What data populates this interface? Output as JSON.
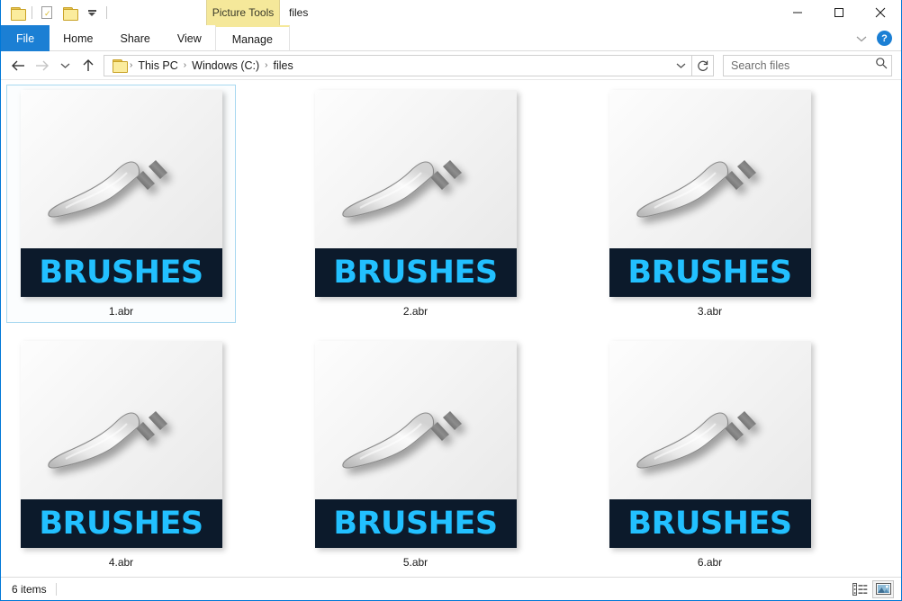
{
  "window": {
    "title": "files",
    "border_color": "#0078d7"
  },
  "quick_access": {
    "items": [
      {
        "name": "folder-icon",
        "label": "Properties folder"
      },
      {
        "name": "properties-icon",
        "label": "Properties"
      },
      {
        "name": "new-folder-icon",
        "label": "New folder"
      },
      {
        "name": "customize-chevron-icon",
        "label": "Customize Quick Access Toolbar"
      }
    ]
  },
  "window_controls": {
    "minimize": "Minimize",
    "maximize": "Maximize",
    "close": "Close"
  },
  "contextual_group": {
    "label": "Picture Tools",
    "color": "#f5e89a"
  },
  "ribbon": {
    "tabs": [
      {
        "label": "File",
        "active_style": "file",
        "accent": "#1b7fd4"
      },
      {
        "label": "Home",
        "active_style": "normal"
      },
      {
        "label": "Share",
        "active_style": "normal"
      },
      {
        "label": "View",
        "active_style": "normal"
      },
      {
        "label": "Manage",
        "active_style": "contextual"
      }
    ],
    "collapse_label": "Minimize the Ribbon",
    "help_label": "?"
  },
  "address_bar": {
    "back_label": "Back",
    "forward_label": "Forward",
    "recent_label": "Recent locations",
    "up_label": "Up",
    "breadcrumb": [
      {
        "label": "This PC"
      },
      {
        "label": "Windows (C:)"
      },
      {
        "label": "files"
      }
    ],
    "separator": "›",
    "dropdown_label": "Previous locations",
    "refresh_label": "Refresh"
  },
  "search": {
    "placeholder": "Search files",
    "icon": "search-icon"
  },
  "files": [
    {
      "name": "1.abr",
      "thumb_text": "BRUSHES",
      "selected": true
    },
    {
      "name": "2.abr",
      "thumb_text": "BRUSHES",
      "selected": false
    },
    {
      "name": "3.abr",
      "thumb_text": "BRUSHES",
      "selected": false
    },
    {
      "name": "4.abr",
      "thumb_text": "BRUSHES",
      "selected": false
    },
    {
      "name": "5.abr",
      "thumb_text": "BRUSHES",
      "selected": false
    },
    {
      "name": "6.abr",
      "thumb_text": "BRUSHES",
      "selected": false
    }
  ],
  "thumbnail_style": {
    "band_color": "#0c1a2b",
    "band_text_color": "#22c0ff"
  },
  "status_bar": {
    "item_count": "6 items",
    "details_view_label": "Details view",
    "large_icons_view_label": "Large icons view",
    "active_view": "large-icons"
  }
}
